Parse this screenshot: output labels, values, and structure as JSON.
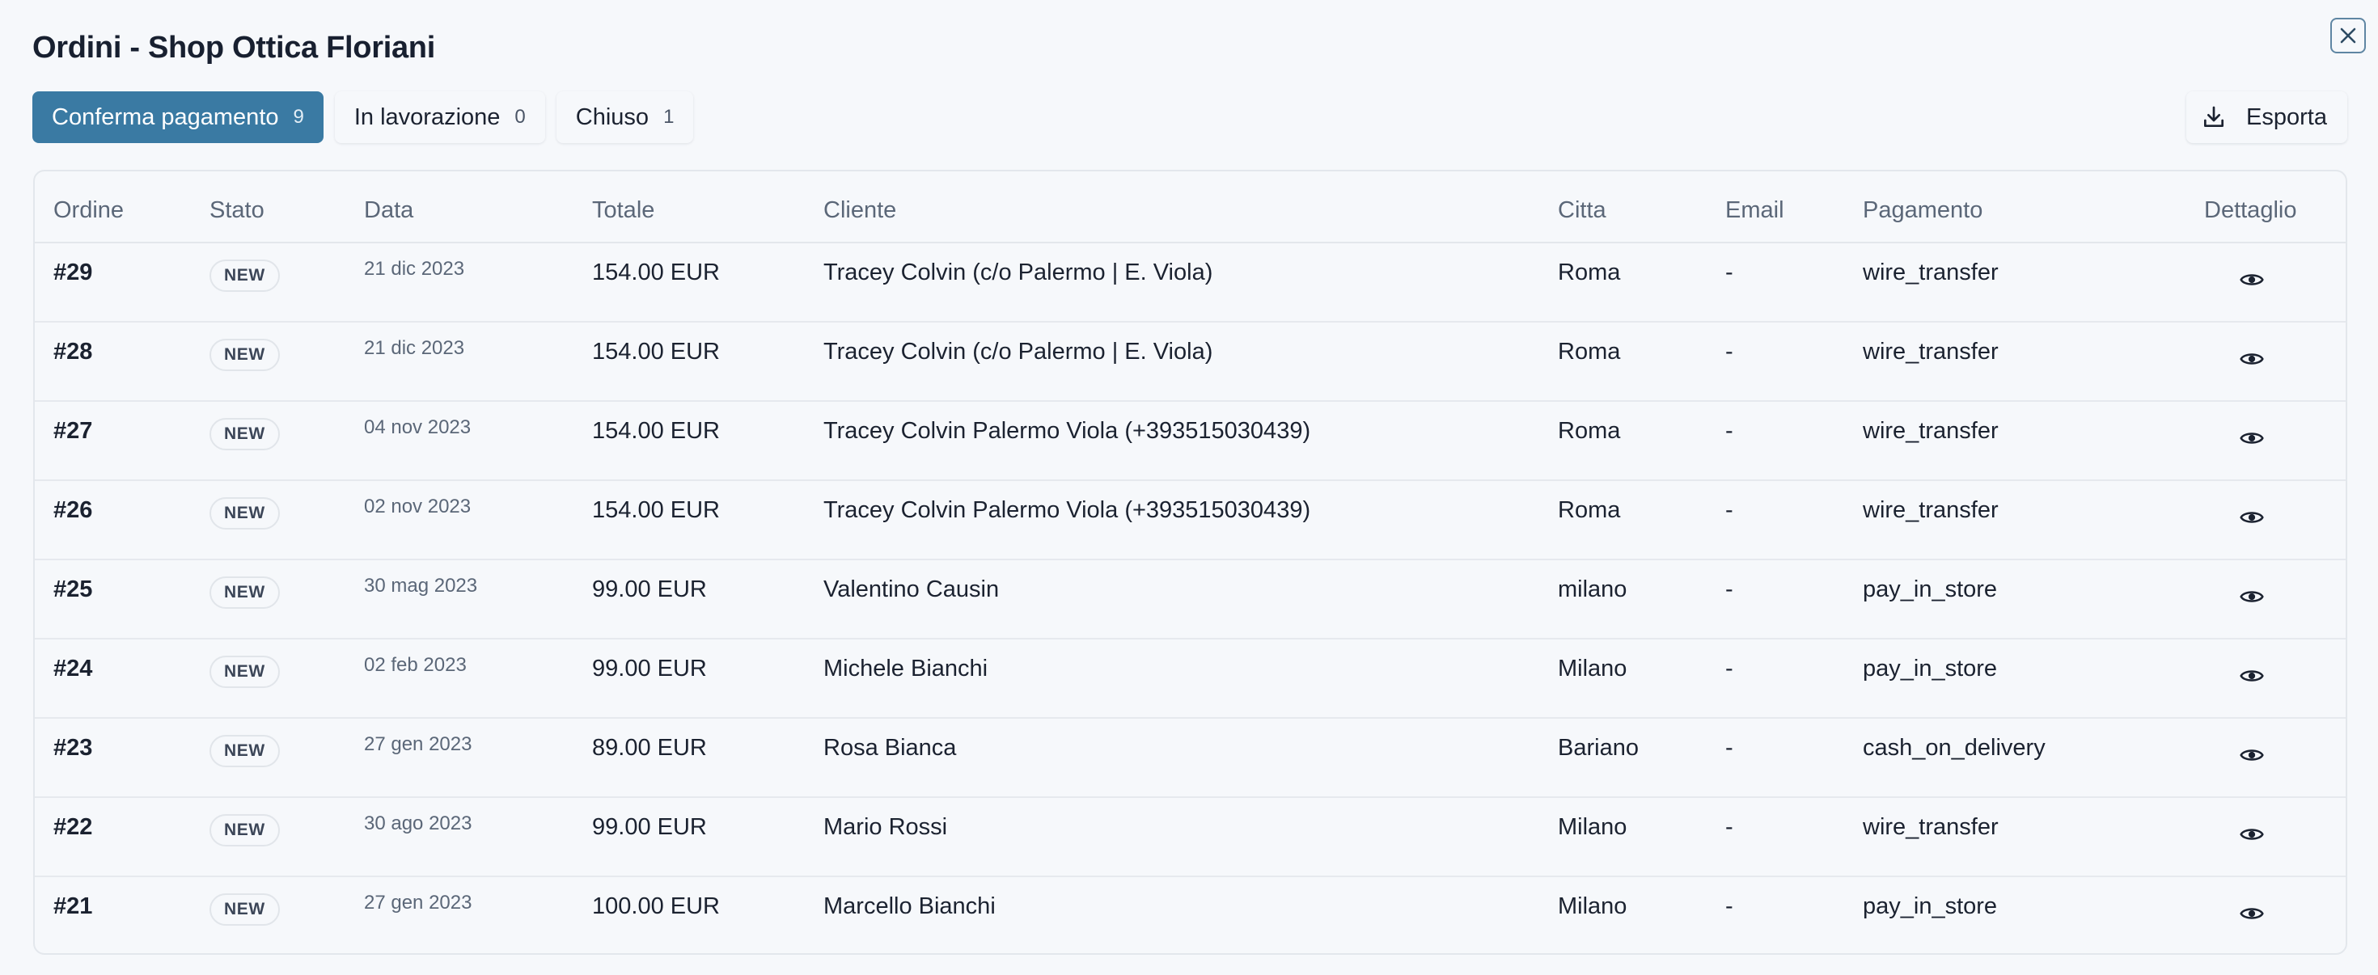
{
  "title": "Ordini - Shop Ottica Floriani",
  "tabs": [
    {
      "label": "Conferma pagamento",
      "count": "9"
    },
    {
      "label": "In lavorazione",
      "count": "0"
    },
    {
      "label": "Chiuso",
      "count": "1"
    }
  ],
  "export": {
    "label": "Esporta",
    "icon": "download-icon"
  },
  "close": {
    "icon": "close-icon"
  },
  "colors": {
    "accent": "#3a7aa3",
    "background": "#f6f8fb"
  },
  "table": {
    "headers": [
      "Ordine",
      "Stato",
      "Data",
      "Totale",
      "Cliente",
      "Citta",
      "Email",
      "Pagamento",
      "Dettaglio"
    ],
    "rows": [
      {
        "order": "#29",
        "status": "NEW",
        "date": "21 dic 2023",
        "total": "154.00 EUR",
        "client": "Tracey Colvin (c/o Palermo | E. Viola)",
        "city": "Roma",
        "email": "-",
        "payment": "wire_transfer"
      },
      {
        "order": "#28",
        "status": "NEW",
        "date": "21 dic 2023",
        "total": "154.00 EUR",
        "client": "Tracey Colvin (c/o Palermo | E. Viola)",
        "city": "Roma",
        "email": "-",
        "payment": "wire_transfer"
      },
      {
        "order": "#27",
        "status": "NEW",
        "date": "04 nov 2023",
        "total": "154.00 EUR",
        "client": "Tracey Colvin Palermo Viola (+393515030439)",
        "city": "Roma",
        "email": "-",
        "payment": "wire_transfer"
      },
      {
        "order": "#26",
        "status": "NEW",
        "date": "02 nov 2023",
        "total": "154.00 EUR",
        "client": "Tracey Colvin Palermo Viola (+393515030439)",
        "city": "Roma",
        "email": "-",
        "payment": "wire_transfer"
      },
      {
        "order": "#25",
        "status": "NEW",
        "date": "30 mag 2023",
        "total": "99.00 EUR",
        "client": "Valentino Causin",
        "city": "milano",
        "email": "-",
        "payment": "pay_in_store"
      },
      {
        "order": "#24",
        "status": "NEW",
        "date": "02 feb 2023",
        "total": "99.00 EUR",
        "client": "Michele Bianchi",
        "city": "Milano",
        "email": "-",
        "payment": "pay_in_store"
      },
      {
        "order": "#23",
        "status": "NEW",
        "date": "27 gen 2023",
        "total": "89.00 EUR",
        "client": "Rosa Bianca",
        "city": "Bariano",
        "email": "-",
        "payment": "cash_on_delivery"
      },
      {
        "order": "#22",
        "status": "NEW",
        "date": "30 ago 2023",
        "total": "99.00 EUR",
        "client": "Mario Rossi",
        "city": "Milano",
        "email": "-",
        "payment": "wire_transfer"
      },
      {
        "order": "#21",
        "status": "NEW",
        "date": "27 gen 2023",
        "total": "100.00 EUR",
        "client": "Marcello Bianchi",
        "city": "Milano",
        "email": "-",
        "payment": "pay_in_store"
      }
    ],
    "detail_icon": "eye-icon"
  }
}
